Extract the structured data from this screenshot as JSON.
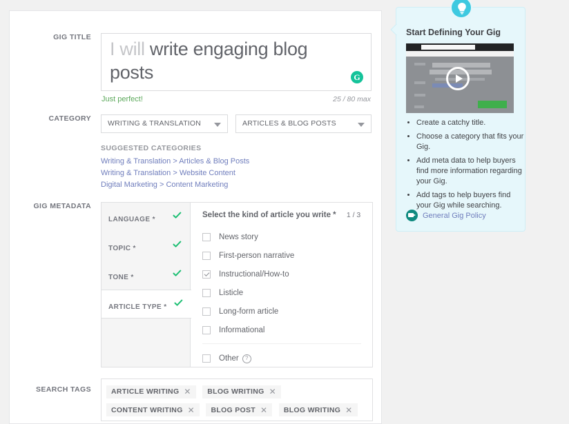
{
  "form": {
    "gig_title": {
      "label": "GIG TITLE",
      "prefix": "I will ",
      "value": "write engaging blog posts",
      "validation_message": "Just perfect!",
      "counter": "25 / 80 max"
    },
    "category": {
      "label": "CATEGORY",
      "primary": "WRITING & TRANSLATION",
      "secondary": "ARTICLES & BLOG POSTS"
    },
    "suggested": {
      "title": "SUGGESTED CATEGORIES",
      "items": [
        "Writing & Translation > Articles & Blog Posts",
        "Writing & Translation > Website Content",
        "Digital Marketing > Content Marketing"
      ]
    },
    "metadata": {
      "label": "GIG METADATA",
      "tabs": [
        {
          "label": "LANGUAGE *",
          "complete": true,
          "active": false
        },
        {
          "label": "TOPIC *",
          "complete": true,
          "active": false
        },
        {
          "label": "TONE *",
          "complete": true,
          "active": false
        },
        {
          "label": "ARTICLE TYPE *",
          "complete": true,
          "active": true
        }
      ],
      "panel_heading": "Select the kind of article you write *",
      "panel_counter": "1 / 3",
      "options": [
        {
          "label": "News story",
          "checked": false
        },
        {
          "label": "First-person narrative",
          "checked": false
        },
        {
          "label": "Instructional/How-to",
          "checked": true
        },
        {
          "label": "Listicle",
          "checked": false
        },
        {
          "label": "Long-form article",
          "checked": false
        },
        {
          "label": "Informational",
          "checked": false
        }
      ],
      "other_option": {
        "label": "Other",
        "checked": false,
        "help": "?"
      }
    },
    "search_tags": {
      "label": "SEARCH TAGS",
      "tags": [
        "ARTICLE WRITING",
        "BLOG WRITING",
        "CONTENT WRITING",
        "BLOG POST",
        "BLOG WRITING"
      ],
      "remove_glyph": "✕"
    }
  },
  "tip_panel": {
    "title": "Start Defining Your Gig",
    "bullets": [
      "Create a catchy title.",
      "Choose a category that fits your Gig.",
      "Add meta data to help buyers find more information regarding your Gig.",
      "Add tags to help buyers find your Gig while searching."
    ],
    "policy_link": "General Gig Policy"
  },
  "colors": {
    "accent_green": "#15c39a",
    "check_green": "#1dbf73",
    "link_blue": "#6f7dbc",
    "tip_bg": "#e6f7fb",
    "tip_badge": "#3ec9e0"
  }
}
